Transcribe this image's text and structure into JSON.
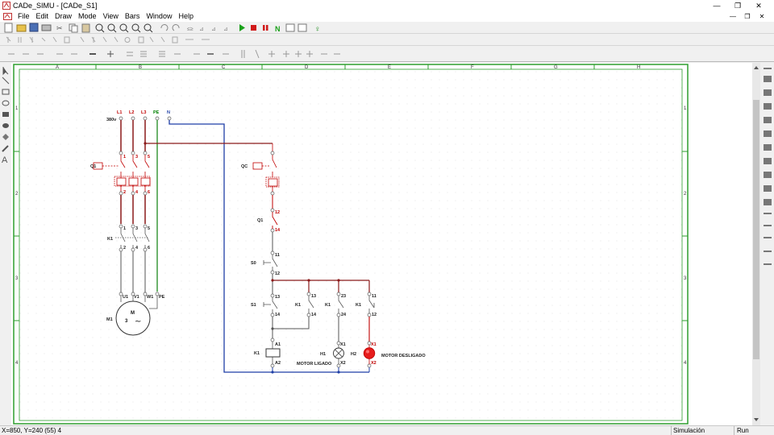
{
  "window": {
    "title": "CADe_SIMU - [CADe_S1]",
    "buttons": [
      "—",
      "❐",
      "✕"
    ]
  },
  "menu": {
    "items": [
      "File",
      "Edit",
      "Draw",
      "Mode",
      "View",
      "Bars",
      "Window",
      "Help"
    ],
    "mdi_buttons": [
      "—",
      "❐",
      "✕"
    ]
  },
  "sheet": {
    "columns": [
      "A",
      "B",
      "C",
      "D",
      "E",
      "F",
      "G",
      "H"
    ],
    "rows": [
      "1",
      "2",
      "3",
      "4"
    ],
    "frame_color": "#2e9e2e"
  },
  "power": {
    "phases": [
      "L1",
      "L2",
      "L3",
      "PE",
      "N"
    ],
    "voltage": "380v",
    "breaker": "Q1",
    "breaker_terminals_top": [
      "1",
      "3",
      "5"
    ],
    "breaker_terminals_bottom": [
      "2",
      "4",
      "6"
    ],
    "contactor": "K1",
    "contactor_terminals_top": [
      "1",
      "3",
      "5"
    ],
    "contactor_terminals_bottom": [
      "2",
      "4",
      "6"
    ],
    "motor": "M1",
    "motor_terminals": [
      "U1",
      "V1",
      "W1",
      "PE"
    ],
    "motor_label": "M",
    "motor_phases": "3",
    "motor_symbol": "~"
  },
  "control": {
    "breaker": "QC",
    "overload": "Q1",
    "overload_terminals": [
      "12",
      "14"
    ],
    "stop_button": "S0",
    "stop_terminals": [
      "11",
      "12"
    ],
    "start_button": "S1",
    "start_terminals": [
      "13",
      "14"
    ],
    "aux_contact_1": "K1",
    "aux_contact_1_terminals": [
      "13",
      "14"
    ],
    "aux_contact_2": "K1",
    "aux_contact_2_terminals": [
      "23",
      "24"
    ],
    "aux_contact_3": "K1",
    "aux_contact_3_terminals": [
      "11",
      "12"
    ],
    "coil": "K1",
    "coil_terminals": [
      "A1",
      "A2"
    ],
    "lamp_on": "H1",
    "lamp_on_terminals": [
      "X1",
      "X2"
    ],
    "lamp_on_text": "MOTOR LIGADO",
    "lamp_off": "H2",
    "lamp_off_terminals": [
      "X1",
      "X2"
    ],
    "lamp_off_text": "MOTOR DESLIGADO"
  },
  "colors": {
    "L1": "#8b1a1a",
    "L2": "#8b1a1a",
    "L3": "#8b1a1a",
    "PE": "#1e8a1e",
    "N": "#1f3fa6",
    "device": "#c00000",
    "lamp_lit": "#e61c1c"
  },
  "status": {
    "coords": "X=850, Y=240 (55) 4",
    "mode": "Simulación",
    "state": "Run"
  }
}
